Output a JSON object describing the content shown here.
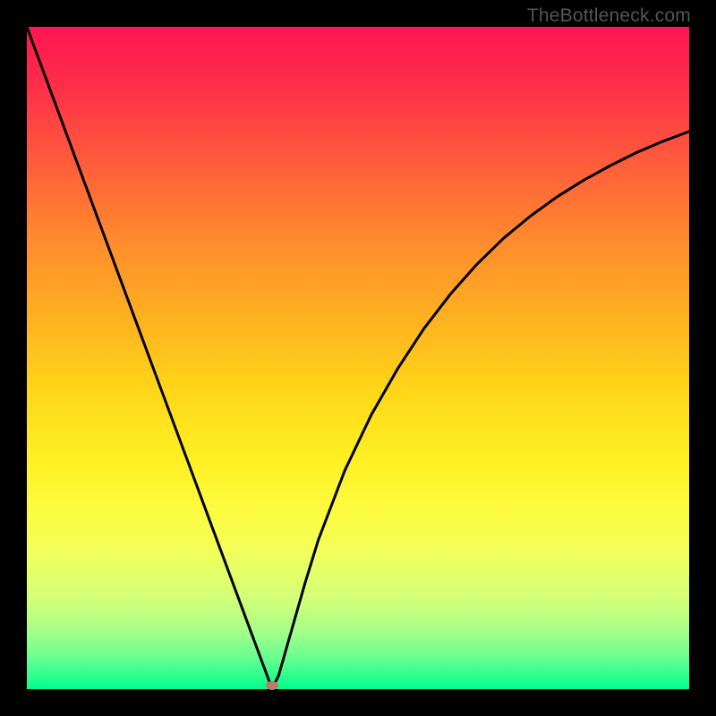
{
  "watermark": "TheBottleneck.com",
  "chart_data": {
    "type": "line",
    "title": "",
    "xlabel": "",
    "ylabel": "",
    "xlim": [
      0,
      100
    ],
    "ylim": [
      0,
      100
    ],
    "grid": false,
    "legend": false,
    "x": [
      0,
      4,
      8,
      12,
      16,
      20,
      24,
      28,
      32,
      34,
      36,
      37,
      38,
      40,
      42,
      44,
      48,
      52,
      56,
      60,
      64,
      68,
      72,
      76,
      80,
      84,
      88,
      92,
      96,
      100
    ],
    "y": [
      100,
      89.2,
      78.4,
      67.6,
      56.8,
      46.0,
      35.2,
      24.4,
      13.6,
      8.2,
      2.8,
      0.1,
      2.0,
      9.0,
      16.0,
      22.5,
      33.0,
      41.4,
      48.4,
      54.5,
      59.7,
      64.2,
      68.1,
      71.4,
      74.3,
      76.8,
      79.0,
      81.0,
      82.7,
      84.2
    ],
    "marker": {
      "x": 37,
      "y": 0
    },
    "background_gradient": [
      "#ff1552",
      "#ffb41f",
      "#ffef22",
      "#00ff8c"
    ]
  }
}
